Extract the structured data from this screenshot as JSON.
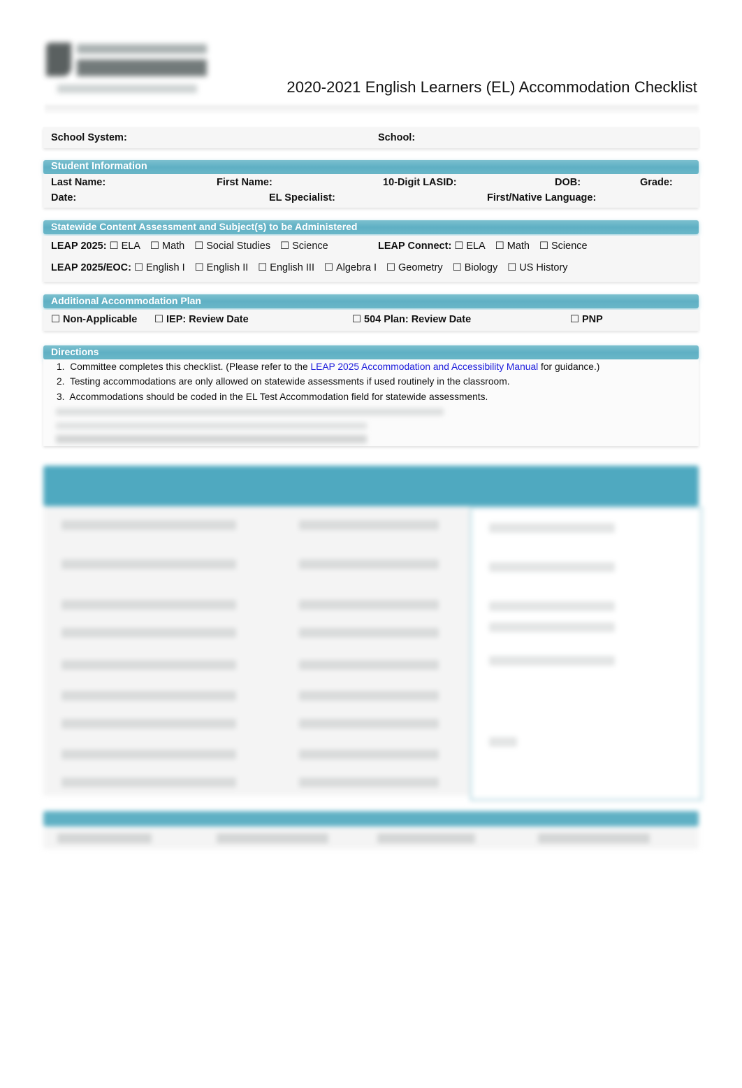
{
  "header": {
    "logo": "state-education-department-logo",
    "title": "2020-2021 English Learners (EL) Accommodation Checklist"
  },
  "school": {
    "system_label": "School System:",
    "school_label": "School:"
  },
  "student_info": {
    "heading": "Student Information",
    "last_name": "Last Name:",
    "first_name": "First Name:",
    "lasid": "10-Digit LASID:",
    "dob": "DOB:",
    "grade": "Grade:",
    "date": "Date:",
    "el_specialist": "EL Specialist:",
    "native_language": "First/Native Language:"
  },
  "assessment": {
    "heading": "Statewide Content Assessment and Subject(s) to be Administered",
    "checkbox_glyph": "☐",
    "leap2025": {
      "label": "LEAP 2025:",
      "options": [
        "ELA",
        "Math",
        "Social Studies",
        "Science"
      ]
    },
    "leap_connect": {
      "label": "LEAP Connect:",
      "options": [
        "ELA",
        "Math",
        "Science"
      ]
    },
    "leap_eoc": {
      "label": "LEAP 2025/EOC:",
      "options": [
        "English I",
        "English II",
        "English III",
        "Algebra I",
        "Geometry",
        "Biology",
        "US History"
      ]
    }
  },
  "plan": {
    "heading": "Additional Accommodation Plan",
    "options": [
      "Non-Applicable",
      "IEP:  Review Date",
      "504 Plan: Review Date",
      "PNP"
    ]
  },
  "directions": {
    "heading": "Directions",
    "items": [
      {
        "num": "1.",
        "before": "Committee completes this checklist. (Please refer to the ",
        "link": "LEAP 2025 Accommodation and Accessibility Manual",
        "after": " for guidance.)"
      },
      {
        "num": "2.",
        "text": "Testing accommodations are only allowed on statewide assessments if used routinely in the classroom."
      },
      {
        "num": "3.",
        "text": "Accommodations should be coded in the EL Test Accommodation field for statewide assessments."
      }
    ]
  },
  "colors": {
    "band": "#5fb0c4",
    "link": "#1a1adb"
  }
}
